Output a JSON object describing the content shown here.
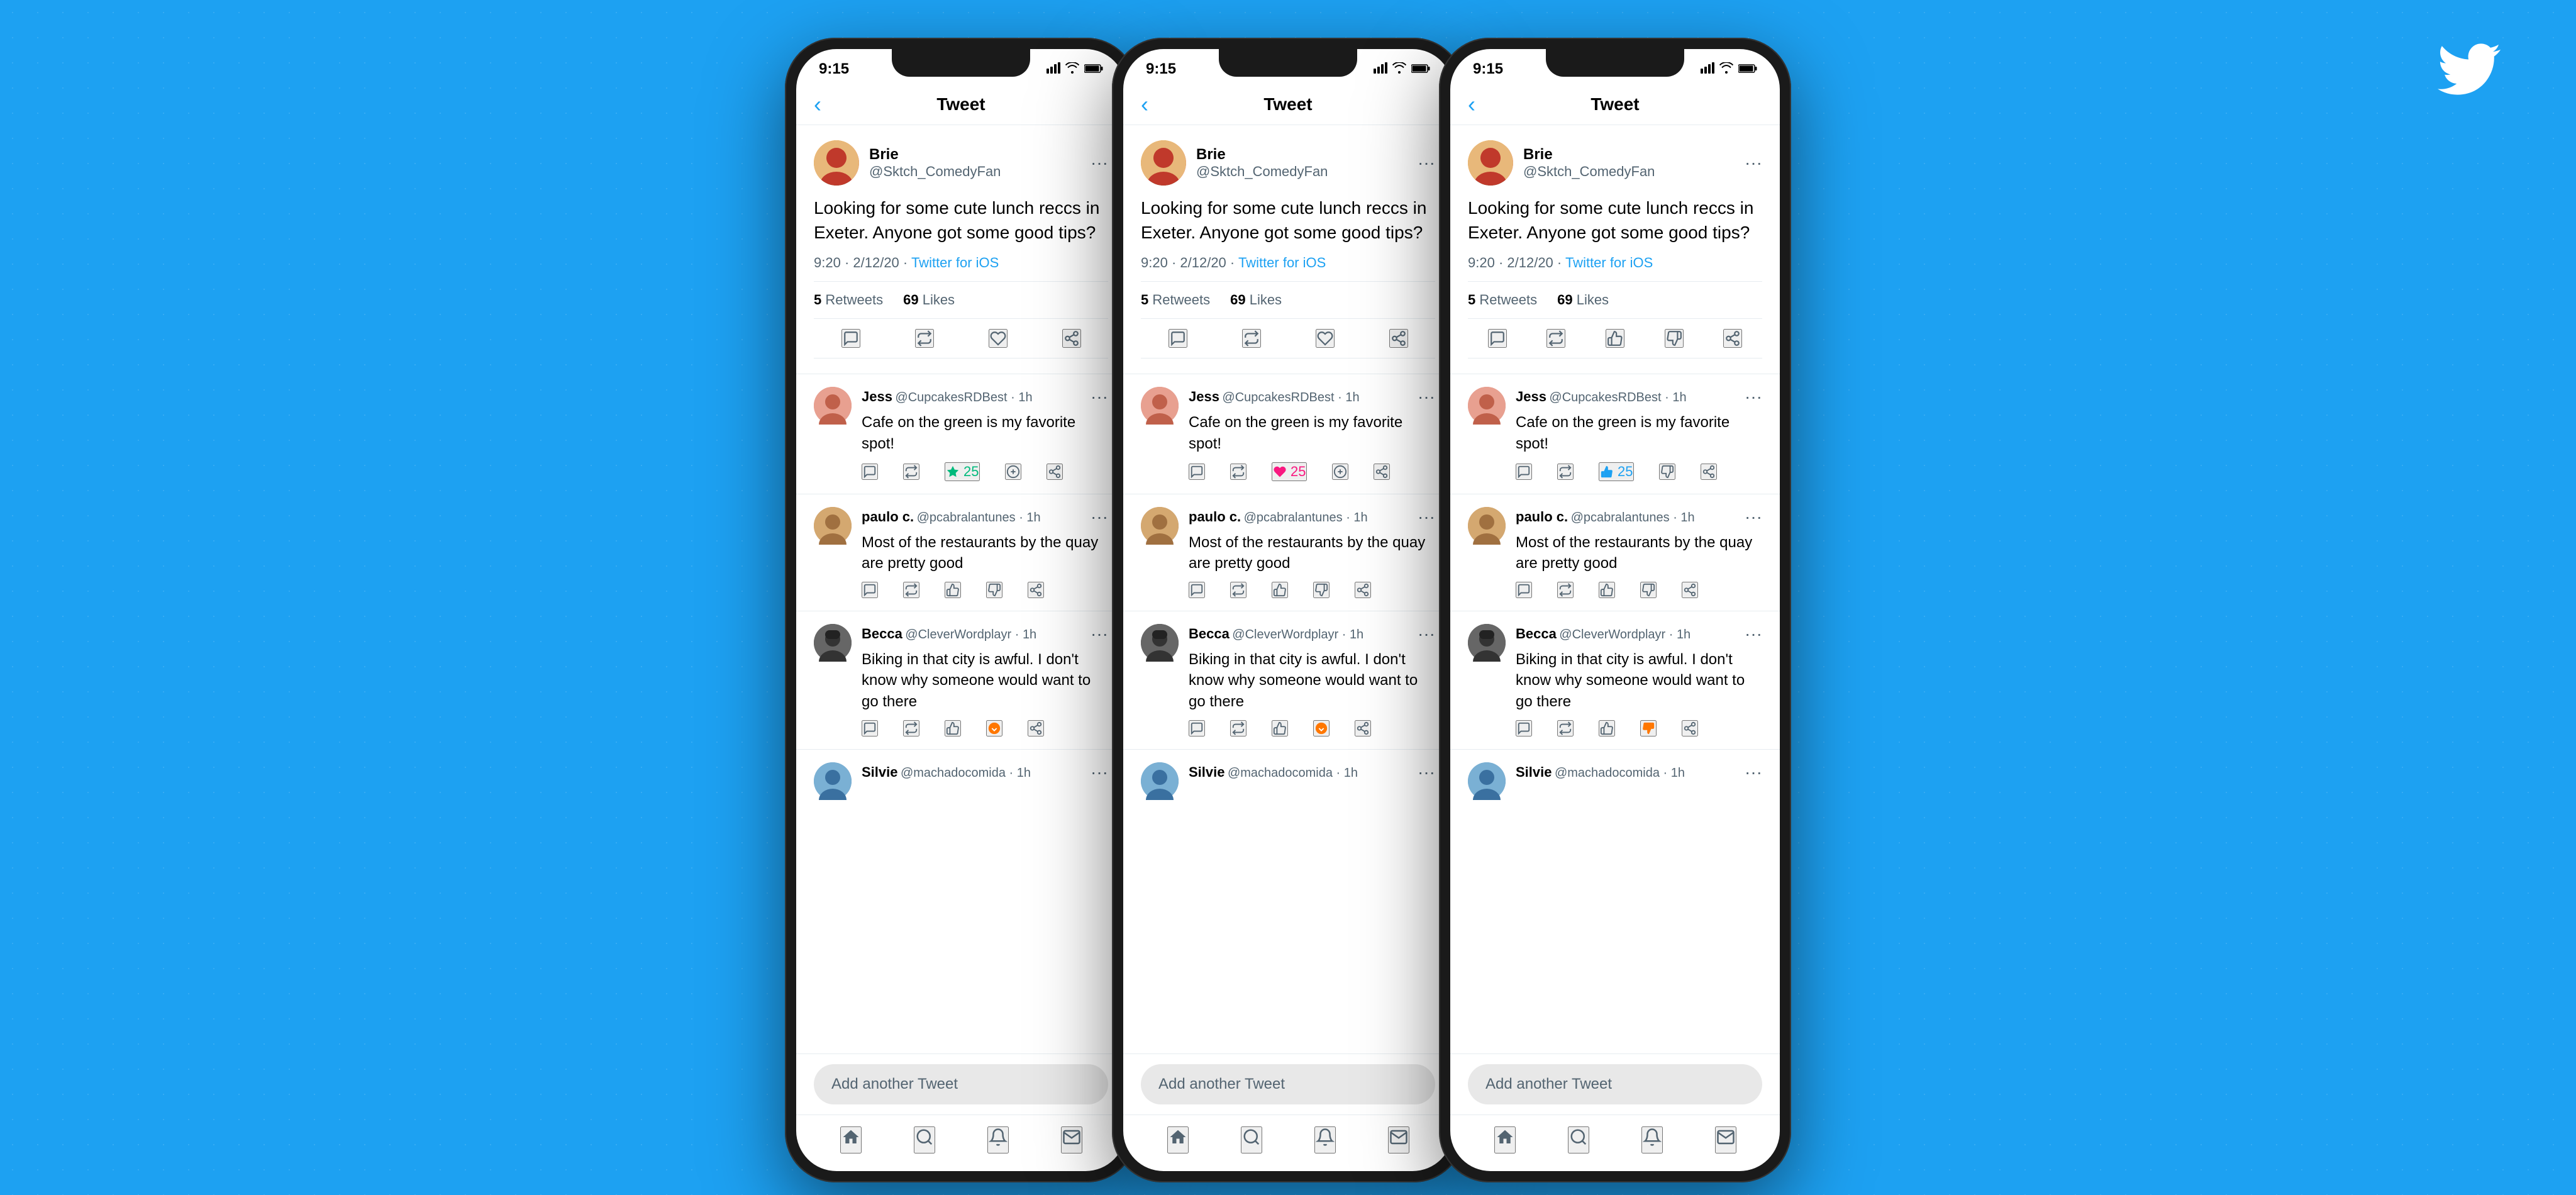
{
  "background_color": "#1DA1F2",
  "twitter_logo": "🐦",
  "phones": [
    {
      "id": "phone1",
      "status_time": "9:15",
      "nav_back": "‹",
      "nav_title": "Tweet",
      "main_tweet": {
        "author_name": "Brie",
        "author_handle": "@Sktch_ComedyFan",
        "tweet_text": "Looking for some cute lunch reccs in Exeter. Anyone got some good tips?",
        "time": "9:20",
        "date": "2/12/20",
        "platform": "Twitter for iOS",
        "retweets": "5",
        "retweets_label": "Retweets",
        "likes": "69",
        "likes_label": "Likes"
      },
      "replies": [
        {
          "author": "Jess",
          "handle": "@CupcakesRDBest · 1h",
          "text": "Cafe on the green is my favorite spot!",
          "action_count": "25",
          "action_type": "retweet_green"
        },
        {
          "author": "paulo c.",
          "handle": "@pcabralantunes · 1h",
          "text": "Most of the restaurants by the quay are pretty good",
          "action_count": "",
          "action_type": "upvote"
        },
        {
          "author": "Becca",
          "handle": "@CleverWordplayr · 1h",
          "text": "Biking in that city is awful. I don't know why someone would want to go there",
          "action_count": "",
          "action_type": "downvote_orange"
        },
        {
          "author": "Silvie",
          "handle": "@machadocomida · 1h",
          "text": "",
          "action_count": "",
          "action_type": "normal"
        }
      ],
      "add_tweet_label": "Add another Tweet",
      "bottom_nav": [
        "🏠",
        "🔍",
        "🔔",
        "✉️"
      ]
    },
    {
      "id": "phone2",
      "status_time": "9:15",
      "nav_back": "‹",
      "nav_title": "Tweet",
      "main_tweet": {
        "author_name": "Brie",
        "author_handle": "@Sktch_ComedyFan",
        "tweet_text": "Looking for some cute lunch reccs in Exeter. Anyone got some good tips?",
        "time": "9:20",
        "date": "2/12/20",
        "platform": "Twitter for iOS",
        "retweets": "5",
        "retweets_label": "Retweets",
        "likes": "69",
        "likes_label": "Likes"
      },
      "replies": [
        {
          "author": "Jess",
          "handle": "@CupcakesRDBest · 1h",
          "text": "Cafe on the green is my favorite spot!",
          "action_count": "25",
          "action_type": "heart_pink"
        },
        {
          "author": "paulo c.",
          "handle": "@pcabralantunes · 1h",
          "text": "Most of the restaurants by the quay are pretty good",
          "action_count": "",
          "action_type": "upvote"
        },
        {
          "author": "Becca",
          "handle": "@CleverWordplayr · 1h",
          "text": "Biking in that city is awful. I don't know why someone would want to go there",
          "action_count": "",
          "action_type": "downvote_orange"
        },
        {
          "author": "Silvie",
          "handle": "@machadocomida · 1h",
          "text": "",
          "action_count": "",
          "action_type": "normal"
        }
      ],
      "add_tweet_label": "Add another Tweet",
      "bottom_nav": [
        "🏠",
        "🔍",
        "🔔",
        "✉️"
      ]
    },
    {
      "id": "phone3",
      "status_time": "9:15",
      "nav_back": "‹",
      "nav_title": "Tweet",
      "main_tweet": {
        "author_name": "Brie",
        "author_handle": "@Sktch_ComedyFan",
        "tweet_text": "Looking for some cute lunch reccs in Exeter. Anyone got some good tips?",
        "time": "9:20",
        "date": "2/12/20",
        "platform": "Twitter for iOS",
        "retweets": "5",
        "retweets_label": "Retweets",
        "likes": "69",
        "likes_label": "Likes"
      },
      "replies": [
        {
          "author": "Jess",
          "handle": "@CupcakesRDBest · 1h",
          "text": "Cafe on the green is my favorite spot!",
          "action_count": "25",
          "action_type": "thumbsup_blue"
        },
        {
          "author": "paulo c.",
          "handle": "@pcabralantunes · 1h",
          "text": "Most of the restaurants by the quay are pretty good",
          "action_count": "",
          "action_type": "thumbs_normal"
        },
        {
          "author": "Becca",
          "handle": "@CleverWordplayr · 1h",
          "text": "Biking in that city is awful. I don't know why someone would want to go there",
          "action_count": "",
          "action_type": "thumbsdown_orange"
        },
        {
          "author": "Silvie",
          "handle": "@machadocomida · 1h",
          "text": "",
          "action_count": "",
          "action_type": "thumbs_normal"
        }
      ],
      "add_tweet_label": "Add another Tweet",
      "bottom_nav": [
        "🏠",
        "🔍",
        "🔔",
        "✉️"
      ]
    }
  ]
}
